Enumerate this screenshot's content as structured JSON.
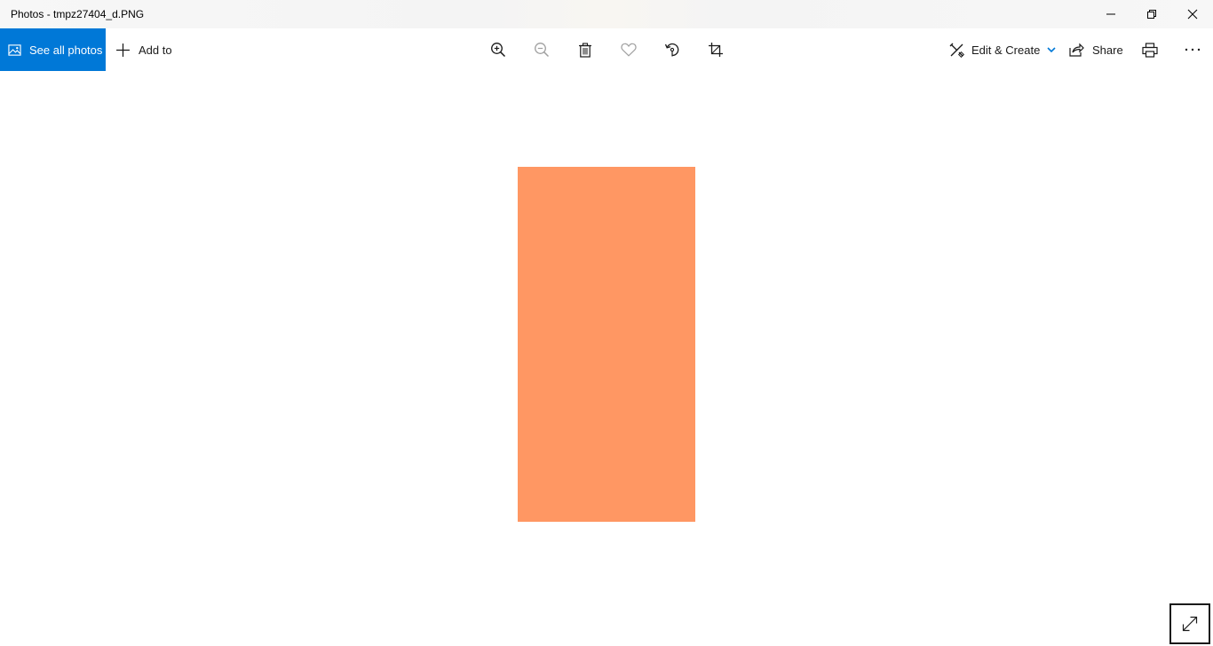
{
  "window": {
    "title": "Photos - tmpz27404_d.PNG"
  },
  "toolbar": {
    "see_all_label": "See all photos",
    "add_to_label": "Add to",
    "edit_create_label": "Edit & Create",
    "share_label": "Share",
    "icons": [
      "zoom-in-icon",
      "zoom-out-icon",
      "delete-icon",
      "favorite-icon",
      "rotate-icon",
      "crop-icon",
      "print-icon",
      "more-icon"
    ]
  },
  "photo": {
    "fill_color": "#ff9763"
  },
  "colors": {
    "accent": "#0078d7",
    "disabled_icon": "#a0a0a0"
  }
}
